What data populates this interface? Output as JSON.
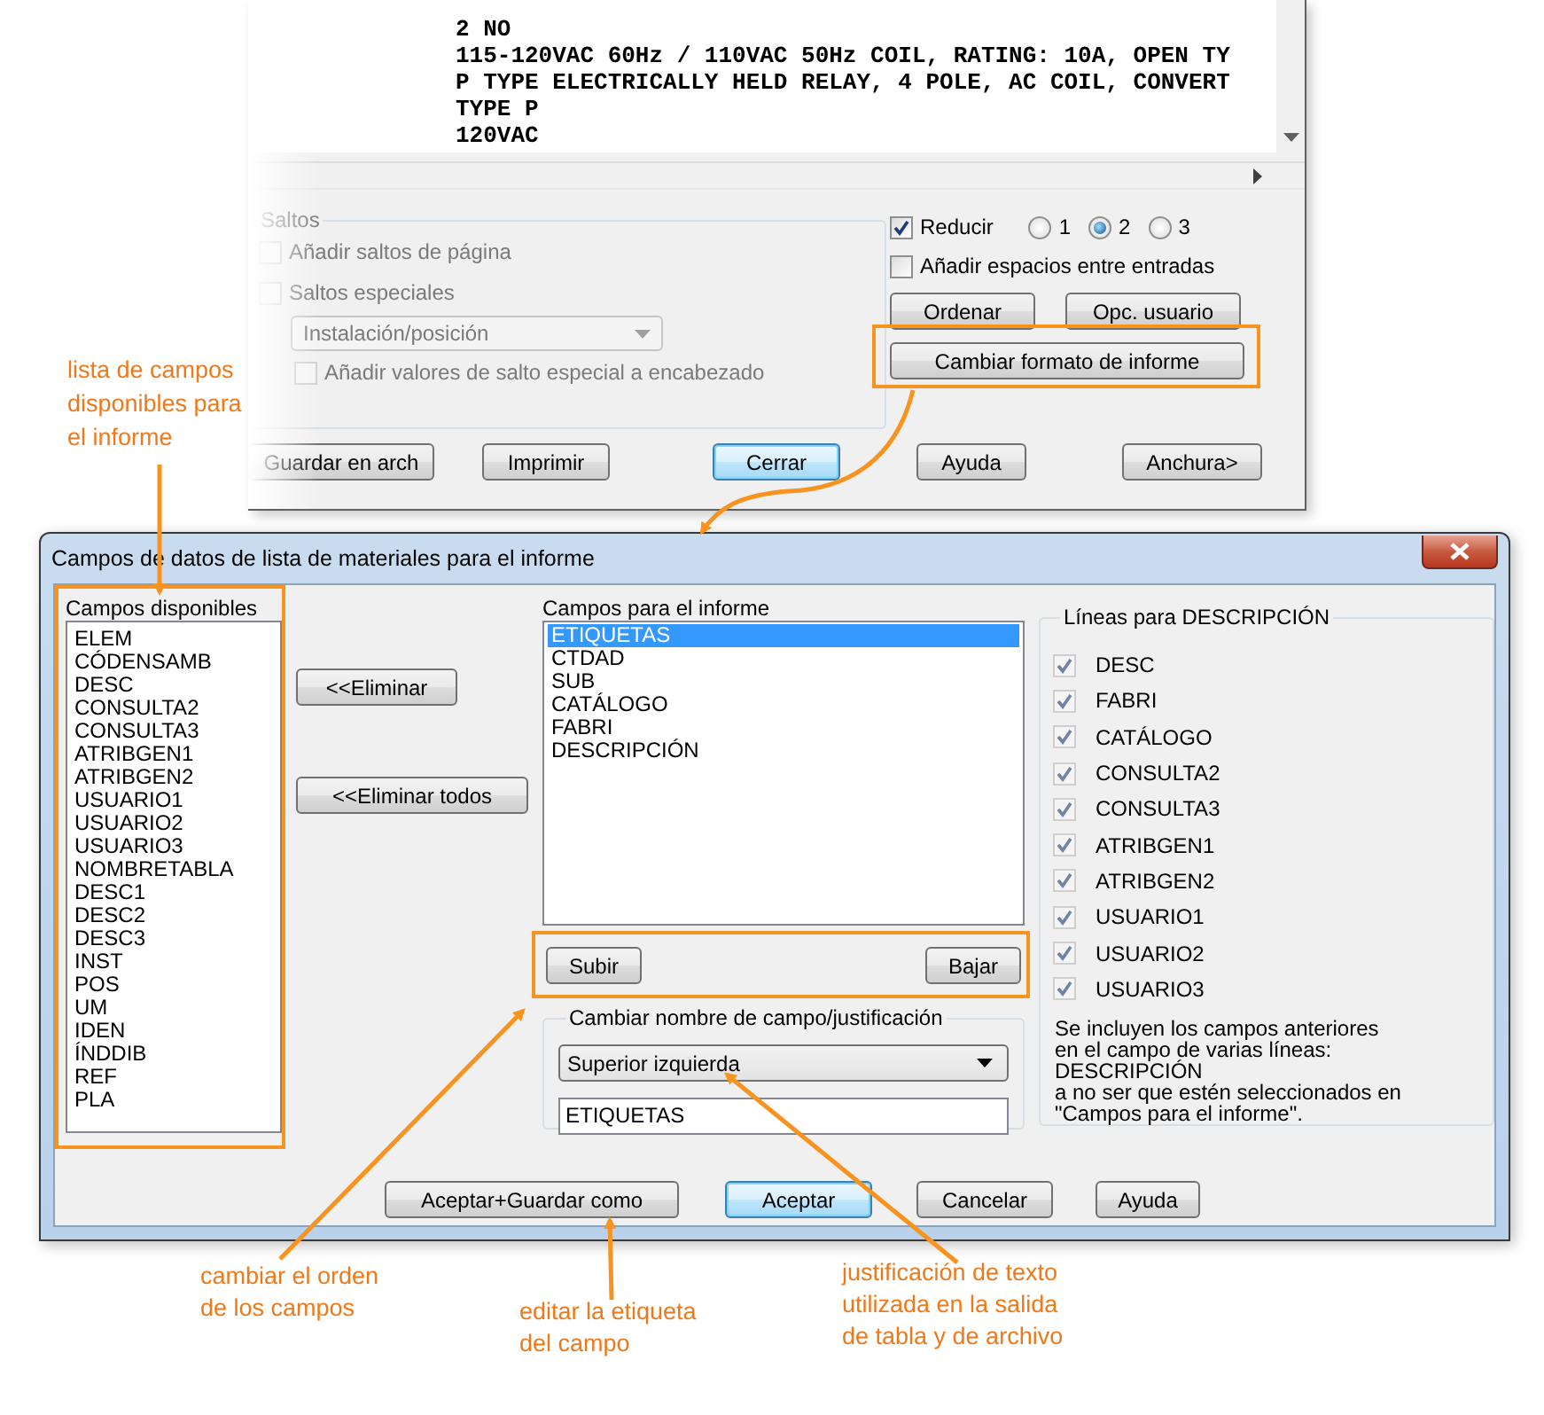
{
  "background_window": {
    "text_lines": [
      "2 NO",
      "115-120VAC 60Hz / 110VAC 50Hz COIL, RATING: 10A, OPEN TY",
      "P TYPE ELECTRICALLY HELD RELAY, 4 POLE, AC COIL, CONVERT",
      "TYPE P",
      "120VAC"
    ],
    "breaks_group": {
      "title": "Saltos",
      "disabled": true,
      "page_breaks": {
        "label": "Añadir saltos de página",
        "checked": false
      },
      "special_breaks": {
        "label": "Saltos especiales",
        "checked": false
      },
      "special_dropdown": {
        "value": "Instalación/posición"
      },
      "add_to_header": {
        "label": "Añadir valores de salto especial a encabezado",
        "checked": false
      }
    },
    "reduce": {
      "label": "Reducir",
      "checked": true
    },
    "reduce_options": [
      {
        "label": "1",
        "selected": false
      },
      {
        "label": "2",
        "selected": true
      },
      {
        "label": "3",
        "selected": false
      }
    ],
    "add_spaces": {
      "label": "Añadir espacios entre entradas",
      "checked": false
    },
    "option_buttons": [
      "Ordenar",
      "Opc. usuario"
    ],
    "format_button": "Cambiar formato de informe",
    "footer_buttons": [
      {
        "label": "Guardar en arch",
        "default": false
      },
      {
        "label": "Imprimir",
        "default": false
      },
      {
        "label": "Cerrar",
        "default": true
      },
      {
        "label": "Ayuda",
        "default": false
      },
      {
        "label": "Anchura>",
        "default": false
      }
    ]
  },
  "dialog": {
    "title": "Campos de datos de lista de materiales para el informe",
    "available": {
      "label": "Campos disponibles",
      "items": [
        "ELEM",
        "CÓDENSAMB",
        "DESC",
        "CONSULTA2",
        "CONSULTA3",
        "ATRIBGEN1",
        "ATRIBGEN2",
        "USUARIO1",
        "USUARIO2",
        "USUARIO3",
        "NOMBRETABLA",
        "DESC1",
        "DESC2",
        "DESC3",
        "INST",
        "POS",
        "UM",
        "IDEN",
        "ÍNDDIB",
        "REF",
        "PLA"
      ]
    },
    "remove_buttons": [
      "<<Eliminar",
      "<<Eliminar todos"
    ],
    "report_fields": {
      "label": "Campos para el informe",
      "items": [
        {
          "text": "ETIQUETAS",
          "selected": true
        },
        {
          "text": "CTDAD",
          "selected": false
        },
        {
          "text": "SUB",
          "selected": false
        },
        {
          "text": "CATÁLOGO",
          "selected": false
        },
        {
          "text": "FABRI",
          "selected": false
        },
        {
          "text": "DESCRIPCIÓN",
          "selected": false
        }
      ]
    },
    "move_buttons": [
      "Subir",
      "Bajar"
    ],
    "rename_group": {
      "title": "Cambiar nombre de campo/justificación",
      "justification": "Superior izquierda",
      "label_value": "ETIQUETAS"
    },
    "description_lines": {
      "title": "Líneas para DESCRIPCIÓN",
      "items": [
        {
          "label": "DESC",
          "checked": true
        },
        {
          "label": "FABRI",
          "checked": true
        },
        {
          "label": "CATÁLOGO",
          "checked": true
        },
        {
          "label": "CONSULTA2",
          "checked": true
        },
        {
          "label": "CONSULTA3",
          "checked": true
        },
        {
          "label": "ATRIBGEN1",
          "checked": true
        },
        {
          "label": "ATRIBGEN2",
          "checked": true
        },
        {
          "label": "USUARIO1",
          "checked": true
        },
        {
          "label": "USUARIO2",
          "checked": true
        },
        {
          "label": "USUARIO3",
          "checked": true
        }
      ],
      "note": "Se incluyen los campos anteriores\nen el campo de varias líneas:\nDESCRIPCIÓN\na no ser que estén seleccionados en\n\"Campos para el informe\"."
    },
    "footer_buttons": [
      {
        "label": "Aceptar+Guardar como",
        "default": false
      },
      {
        "label": "Aceptar",
        "default": true
      },
      {
        "label": "Cancelar",
        "default": false
      },
      {
        "label": "Ayuda",
        "default": false
      }
    ]
  },
  "callouts": [
    {
      "text": "lista de campos\ndisponibles para\nel informe"
    },
    {
      "text": "cambiar el orden\nde los campos"
    },
    {
      "text": "editar la etiqueta\ndel campo"
    },
    {
      "text": "justificación de texto\nutilizada en la salida\nde tabla y de archivo"
    }
  ]
}
